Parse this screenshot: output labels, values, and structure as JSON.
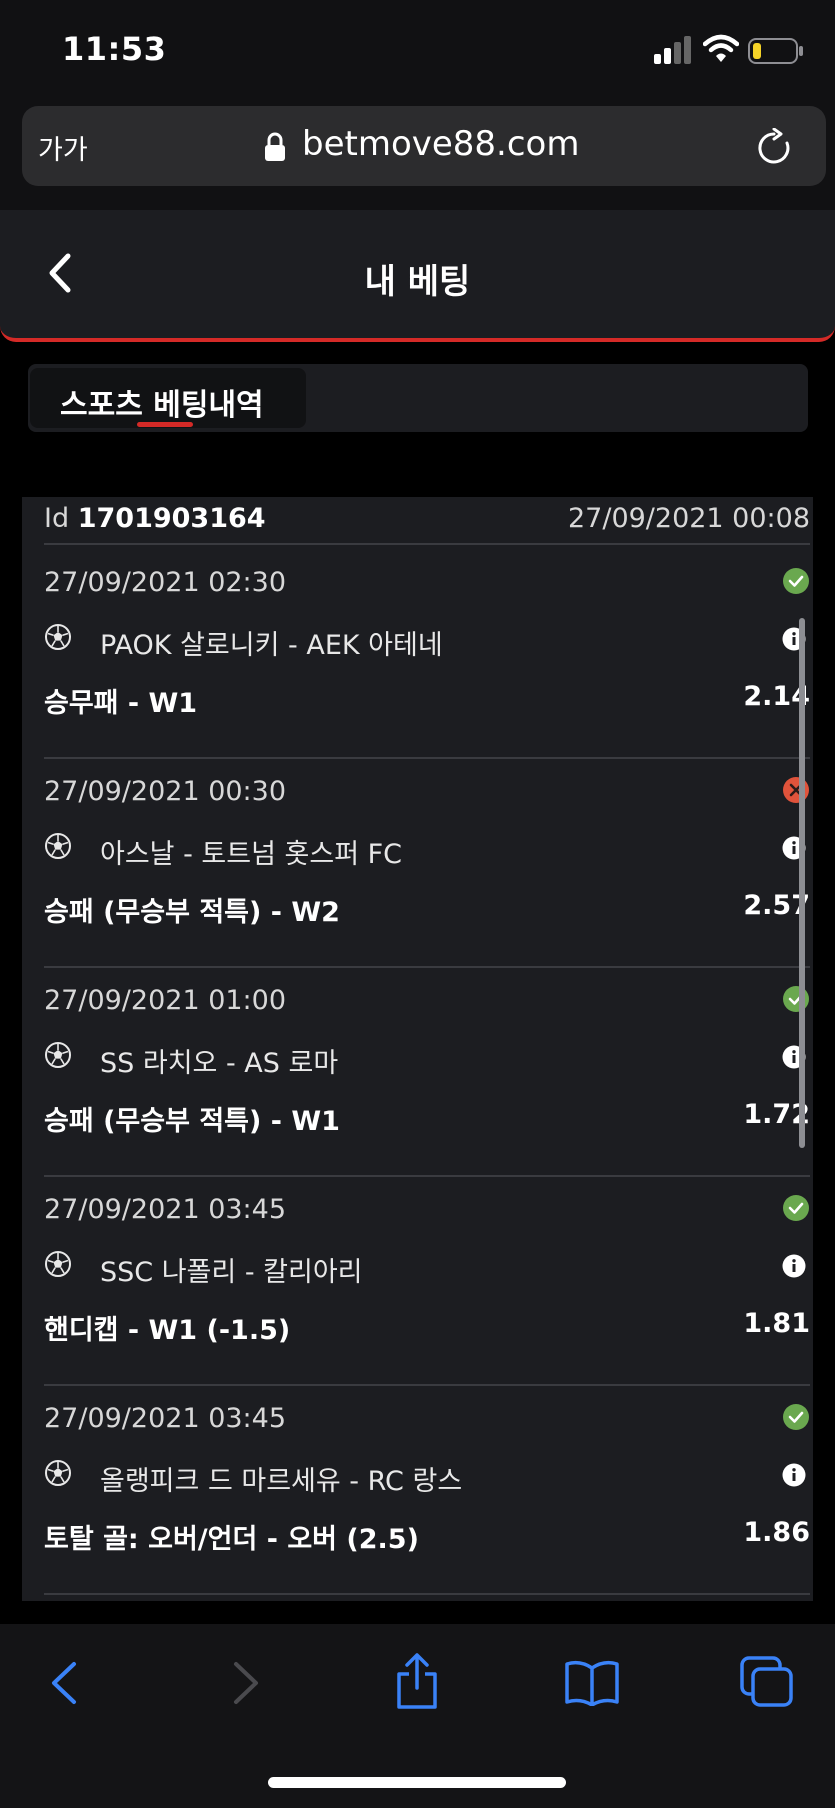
{
  "status_bar": {
    "time": "11:53"
  },
  "browser": {
    "text_size_label": "가가",
    "domain": "betmove88.com"
  },
  "header": {
    "title": "내 베팅"
  },
  "tabs": [
    {
      "label": "스포츠 베팅내역",
      "active": true
    }
  ],
  "bet": {
    "id_label": "Id",
    "id_value": "1701903164",
    "placed_at": "27/09/2021 00:08",
    "events": [
      {
        "date": "27/09/2021 02:30",
        "status": "won",
        "match": "PAOK 살로니키 - AEK 아테네",
        "market": "승무패 - W1",
        "odds": "2.14"
      },
      {
        "date": "27/09/2021 00:30",
        "status": "lost",
        "match": "아스날 - 토트넘 홋스퍼 FC",
        "market": "승패 (무승부 적특) - W2",
        "odds": "2.57"
      },
      {
        "date": "27/09/2021 01:00",
        "status": "won",
        "match": "SS 라치오 - AS 로마",
        "market": "승패 (무승부 적특) - W1",
        "odds": "1.72"
      },
      {
        "date": "27/09/2021 03:45",
        "status": "won",
        "match": "SSC 나폴리 - 칼리아리",
        "market": "핸디캡 - W1 (-1.5)",
        "odds": "1.81"
      },
      {
        "date": "27/09/2021 03:45",
        "status": "won",
        "match": "올랭피크 드 마르세유 - RC 랑스",
        "market": "토탈 골: 오버/언더 - 오버 (2.5)",
        "odds": "1.86"
      }
    ]
  },
  "colors": {
    "accent": "#d42a27",
    "won": "#6aa84f",
    "lost": "#e0533b",
    "toolbar_icon": "#3a82f7"
  }
}
